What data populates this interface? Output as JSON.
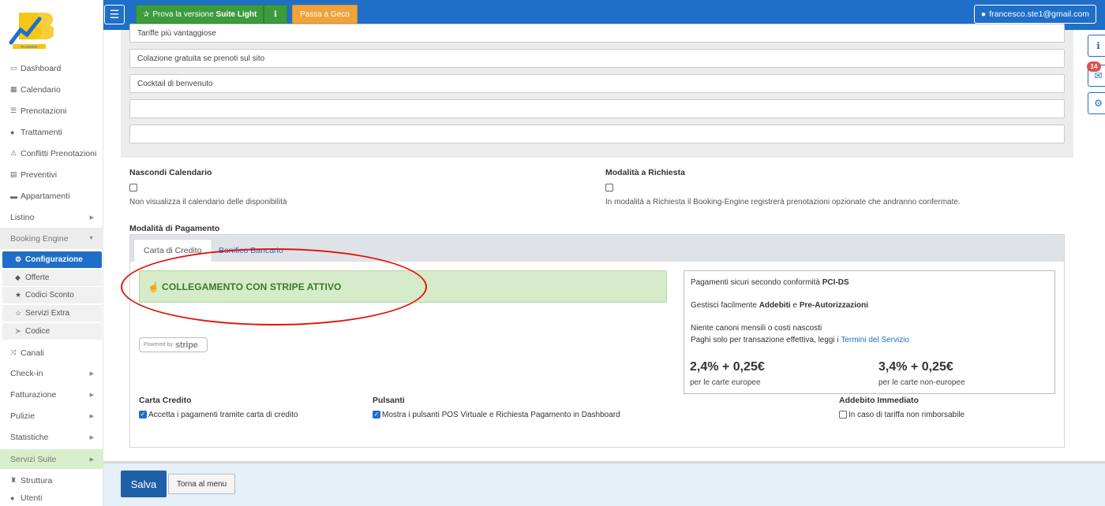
{
  "app": {
    "logo_colors": {
      "primary": "#1f6fc8",
      "secondary": "#f5c518"
    }
  },
  "sidebar": {
    "items": [
      {
        "label": "Dashboard",
        "icon": "monitor-icon"
      },
      {
        "label": "Calendario",
        "icon": "calendar-icon"
      },
      {
        "label": "Prenotazioni",
        "icon": "list-icon"
      },
      {
        "label": "Trattamenti",
        "icon": "apple-icon"
      },
      {
        "label": "Conflitti Prenotazioni",
        "icon": "warning-icon"
      },
      {
        "label": "Preventivi",
        "icon": "document-icon"
      },
      {
        "label": "Appartamenti",
        "icon": "bed-icon"
      },
      {
        "label": "Listino"
      },
      {
        "label": "Booking Engine"
      },
      {
        "label": "Canali",
        "icon": "random-icon"
      },
      {
        "label": "Check-in"
      },
      {
        "label": "Fatturazione"
      },
      {
        "label": "Pulizie"
      },
      {
        "label": "Statistiche"
      },
      {
        "label": "Servizi Suite"
      },
      {
        "label": "Struttura",
        "icon": "tower-icon"
      },
      {
        "label": "Utenti",
        "icon": "user-icon"
      }
    ],
    "booking_sub": [
      {
        "label": "Configurazione",
        "icon": "gear-icon"
      },
      {
        "label": "Offerte",
        "icon": "tag-icon"
      },
      {
        "label": "Codici Sconto",
        "icon": "star-icon"
      },
      {
        "label": "Servizi Extra",
        "icon": "star-outline-icon"
      },
      {
        "label": "Codice",
        "icon": "terminal-icon"
      }
    ]
  },
  "topbar": {
    "suite_prefix": "Prova la versione",
    "suite_bold": "Suite Light",
    "geco_label": "Passa a Geco",
    "user_email": "francesco.ste1@gmail.com"
  },
  "float": {
    "badge_count": "14"
  },
  "offers": {
    "rows": [
      "Tariffe più vantaggiose",
      "Colazione gratuita se prenoti sul sito",
      "Cocktail di benvenuto",
      "",
      ""
    ]
  },
  "options": {
    "hide_calendar_title": "Nascondi Calendario",
    "hide_calendar_help": "Non visualizza il calendario delle disponibilità",
    "request_mode_title": "Modalità a Richiesta",
    "request_mode_help": "In modalità a Richiesta il Booking-Engine registrerà prenotazioni opzionate che andranno confermate."
  },
  "payment": {
    "section_title": "Modalità di Pagamento",
    "tabs": [
      "Carta di Credito",
      "Bonifico Bancario"
    ],
    "stripe_alert": "COLLEGAMENTO CON STRIPE ATTIVO",
    "stripe_badge_prefix": "Powered by",
    "stripe_badge_brand": "stripe",
    "info": {
      "line1_prefix": "Pagamenti sicuri secondo conformità",
      "line1_bold": "PCI-DS",
      "line2_prefix": "Gestisci facilmente",
      "line2_bold1": "Addebiti",
      "line2_mid": "e",
      "line2_bold2": "Pre-Autorizzazioni",
      "line3": "Niente canoni mensili o costi nascosti",
      "line4_prefix": "Paghi solo per transazione effettiva, leggi i",
      "line4_link": "Termini del Servizio",
      "price_eu": "2,4% + 0,25€",
      "price_eu_sub": "per le carte europee",
      "price_non_eu": "3,4% + 0,25€",
      "price_non_eu_sub": "per le carte non-europee"
    },
    "card_title": "Carta Credito",
    "card_option": "Accetta i pagamenti tramite carta di credito",
    "buttons_title": "Pulsanti",
    "buttons_option": "Mostra i pulsanti POS Virtuale e Richiesta Pagamento in Dashboard",
    "immediate_title": "Addebito Immediato",
    "immediate_option": "In caso di tariffa non rimborsabile"
  },
  "footer": {
    "save_label": "Salva",
    "back_label": "Torna al menu"
  }
}
